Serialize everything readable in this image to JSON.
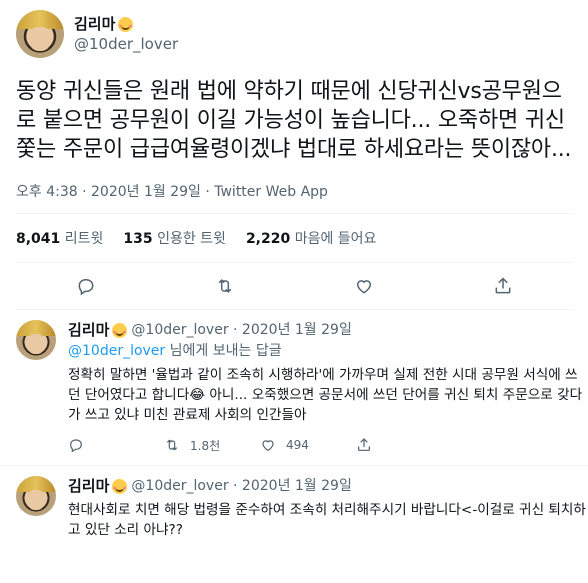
{
  "tweet": {
    "author": {
      "display_name": "김리마",
      "handle": "@10der_lover",
      "emoji": "smiling-blush-emoji"
    },
    "text": "동양 귀신들은 원래 법에 약하기 때문에 신당귀신vs공무원으로 붙으면 공무원이 이길 가능성이 높습니다... 오죽하면 귀신 쫓는 주문이 급급여율령이겠냐 법대로 하세요라는 뜻이잖아...",
    "meta": "오후 4:38 · 2020년 1월 29일 · Twitter Web App",
    "stats": {
      "retweets_count": "8,041",
      "retweets_label": "리트윗",
      "quotes_count": "135",
      "quotes_label": "인용한 트윗",
      "likes_count": "2,220",
      "likes_label": "마음에 들어요"
    },
    "actions": [
      "reply-icon",
      "retweet-icon",
      "like-icon",
      "share-icon"
    ]
  },
  "replies": [
    {
      "display_name": "김리마",
      "handle_date": "@10der_lover · 2020년 1월 29일",
      "to_mention": "@10der_lover",
      "to_suffix": " 님에게 보내는 답글",
      "text": "정확히 말하면 '율법과 같이 조속히 시행하라'에 가까우며 실제 전한 시대 공무원 서식에 쓰던 단어였다고 합니다😂 아니... 오죽했으면 공문서에 쓰던 단어를 귀신 퇴치 주문으로 갖다가 쓰고 있냐 미친 관료제 사회의 인간들아",
      "retweets": "1.8천",
      "likes": "494"
    },
    {
      "display_name": "김리마",
      "handle_date": "@10der_lover · 2020년 1월 29일",
      "text": "현대사회로 치면 해당 법령을 준수하여 조속히 처리해주시기 바랍니다<-이걸로 귀신 퇴치하고 있단 소리 아냐??"
    }
  ],
  "colors": {
    "accent": "#1d9bf0",
    "text": "#0f1419",
    "muted": "#536471",
    "divider": "#eff3f4"
  }
}
